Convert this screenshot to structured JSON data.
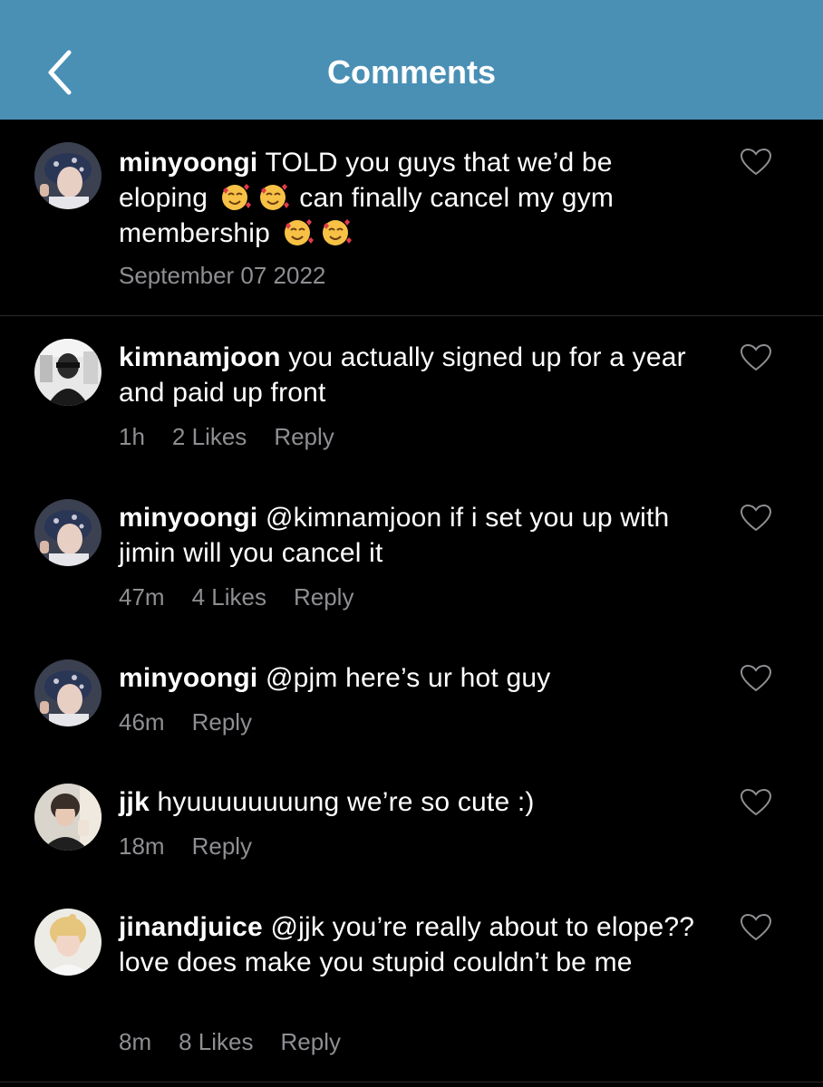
{
  "header": {
    "title": "Comments",
    "back_icon": "chevron-left-icon",
    "bg_color": "#4a90b5"
  },
  "caption": {
    "username": "minyoongi",
    "text_1": "TOLD you guys that we’d be eloping",
    "text_2": "can finally cancel my gym membership",
    "date": "September 07 2022"
  },
  "comments": [
    {
      "username": "kimnamjoon",
      "text": "you actually signed up for a year and paid up front",
      "time": "1h",
      "likes": "2 Likes",
      "reply": "Reply"
    },
    {
      "username": "minyoongi",
      "text": "@kimnamjoon if i set you up with jimin will you cancel it",
      "time": "47m",
      "likes": "4 Likes",
      "reply": "Reply"
    },
    {
      "username": "minyoongi",
      "text": "@pjm here’s ur hot guy",
      "time": "46m",
      "reply": "Reply"
    },
    {
      "username": "jjk",
      "text": "hyuuuuuuuung we’re so cute :)",
      "time": "18m",
      "reply": "Reply"
    },
    {
      "username": "jinandjuice",
      "text": "@jjk you’re really about to elope?? love does make you stupid couldn’t be me",
      "time": "8m",
      "likes": "8 Likes",
      "reply": "Reply"
    }
  ],
  "colors": {
    "background": "#000000",
    "text": "#ffffff",
    "meta": "#8e8e93",
    "heart_outline": "#8e8e93"
  }
}
